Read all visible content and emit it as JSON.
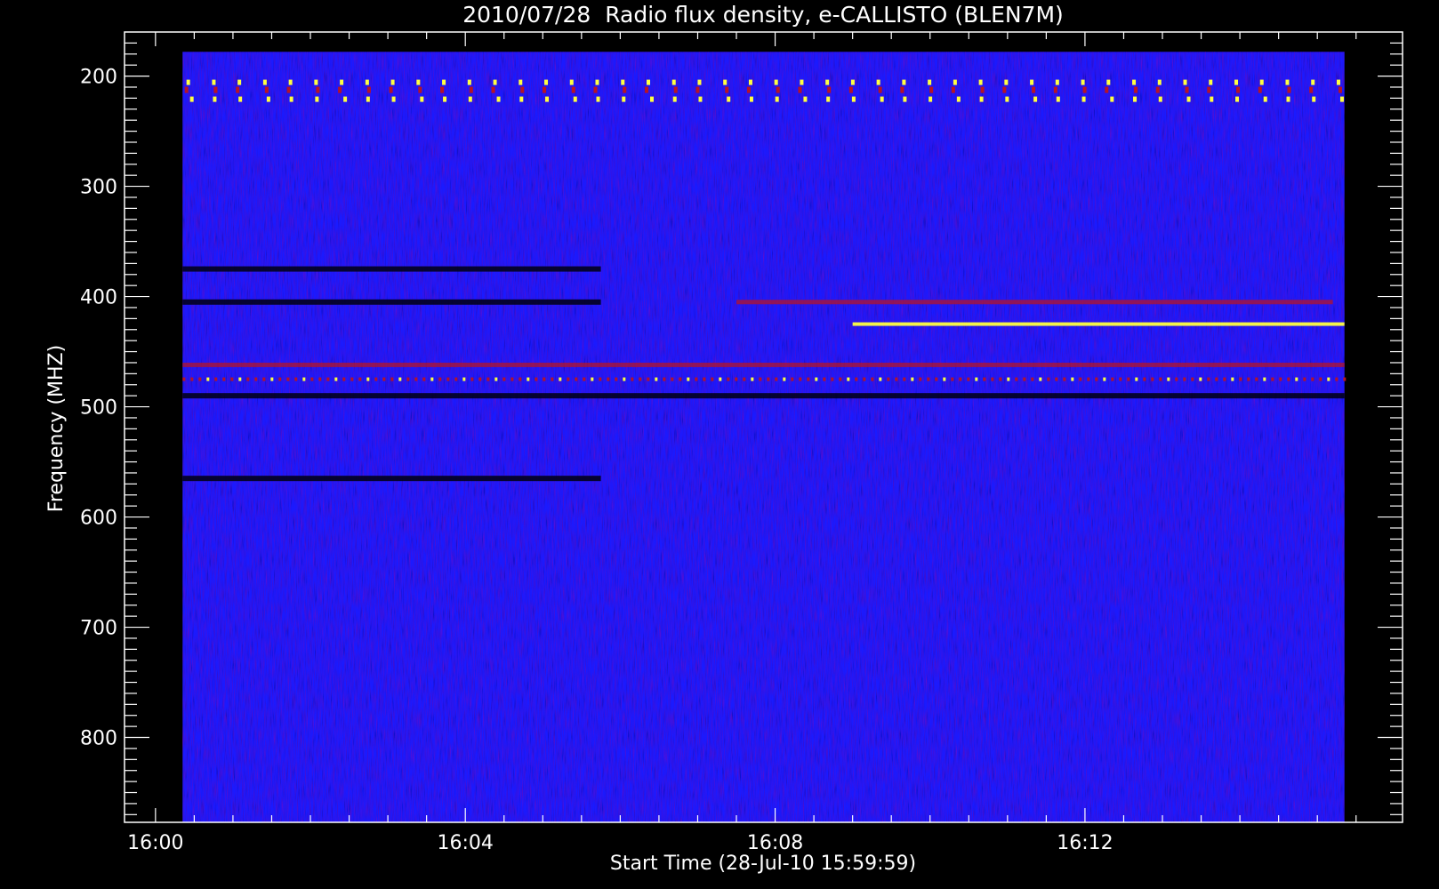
{
  "chart_data": {
    "type": "heatmap",
    "title": "2010/07/28  Radio flux density, e-CALLISTO (BLEN7M)",
    "xlabel": "Start Time (28-Jul-10 15:59:59)",
    "ylabel": "Frequency (MHZ)",
    "x_ticks": [
      "16:00",
      "16:04",
      "16:08",
      "16:12"
    ],
    "x_tick_minutes": [
      0,
      4,
      8,
      12
    ],
    "x_range_minutes": [
      -0.4,
      16.1
    ],
    "x_data_minutes": [
      0.35,
      15.35
    ],
    "y_ticks": [
      200,
      300,
      400,
      500,
      600,
      700,
      800
    ],
    "y_range": [
      160,
      877
    ],
    "y_data": [
      178,
      877
    ],
    "y_inverted": true,
    "grid": false,
    "colormap": "blue-red-yellow",
    "colors": {
      "background": "#000000",
      "axes": "#ffffff",
      "low": "#1a1aff",
      "mid": "#b41428",
      "high": "#ffff40"
    },
    "features": [
      {
        "kind": "periodic_bursts",
        "freq": [
          200,
          225
        ],
        "t_start": 0.35,
        "t_end": 15.35,
        "period_min": 0.33
      },
      {
        "kind": "dark_band",
        "freq": 375,
        "t_start": 0.35,
        "t_end": 5.75
      },
      {
        "kind": "dark_band",
        "freq": 405,
        "t_start": 0.35,
        "t_end": 5.75
      },
      {
        "kind": "dark_band",
        "freq": 565,
        "t_start": 0.35,
        "t_end": 5.75
      },
      {
        "kind": "emission_band",
        "freq": 425,
        "t_start": 9.0,
        "t_end": 15.35,
        "intensity": "high"
      },
      {
        "kind": "emission_band",
        "freq": 405,
        "t_start": 7.5,
        "t_end": 15.2,
        "intensity": "mid"
      },
      {
        "kind": "emission_band",
        "freq": 462,
        "t_start": 0.35,
        "t_end": 15.35,
        "intensity": "mid"
      },
      {
        "kind": "emission_band",
        "freq": 475,
        "t_start": 0.35,
        "t_end": 15.35,
        "intensity": "dotted"
      },
      {
        "kind": "dark_band",
        "freq": 490,
        "t_start": 0.35,
        "t_end": 15.35
      }
    ]
  }
}
